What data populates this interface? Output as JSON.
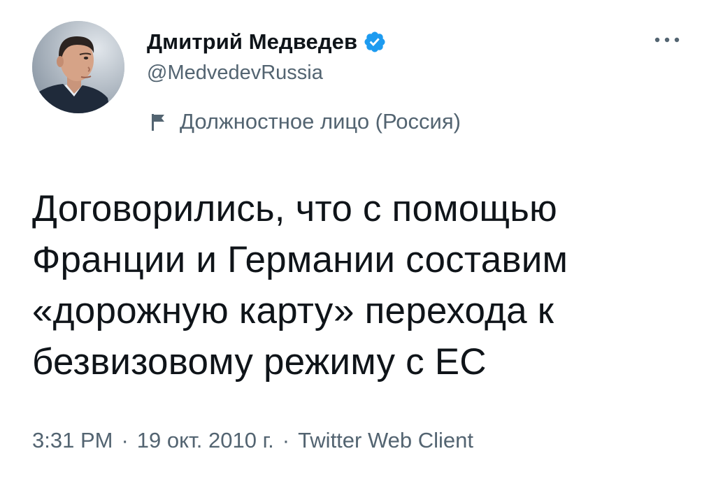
{
  "author": {
    "name": "Дмитрий Медведев",
    "handle": "@MedvedevRussia",
    "verified": true,
    "verified_color": "#1d9bf0"
  },
  "label": {
    "icon": "flag-icon",
    "text": "Должностное лицо (Россия)"
  },
  "tweet": {
    "lines": [
      "Договорились, что с помощью",
      "Франции и Германии составим",
      "«дорожную карту» перехода к",
      "безвизовому режиму с ЕС"
    ]
  },
  "meta": {
    "time": "3:31 PM",
    "date": "19 окт. 2010 г.",
    "source": "Twitter Web Client",
    "separator": "·"
  },
  "icons": {
    "more": "more-horizontal-icon",
    "verified": "verified-badge-icon",
    "avatar": "avatar-photo"
  },
  "colors": {
    "text_primary": "#0f1419",
    "text_secondary": "#536471",
    "background": "#ffffff"
  }
}
